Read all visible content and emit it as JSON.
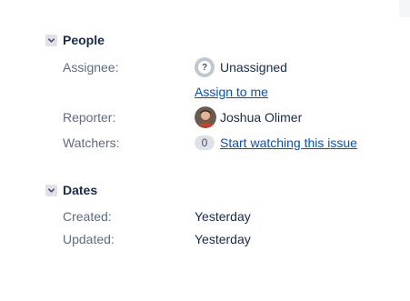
{
  "people": {
    "title": "People",
    "assignee": {
      "label": "Assignee:",
      "value": "Unassigned",
      "assign_link": "Assign to me"
    },
    "reporter": {
      "label": "Reporter:",
      "value": "Joshua Olimer"
    },
    "watchers": {
      "label": "Watchers:",
      "count": "0",
      "watch_link": "Start watching this issue"
    }
  },
  "dates": {
    "title": "Dates",
    "created": {
      "label": "Created:",
      "value": "Yesterday"
    },
    "updated": {
      "label": "Updated:",
      "value": "Yesterday"
    }
  },
  "icons": {
    "collapse": "chevron-down-icon",
    "unassigned": "unassigned-avatar-icon",
    "reporter": "user-avatar"
  },
  "colors": {
    "link": "#0052cc",
    "label": "#5e6c84",
    "text": "#172b4d"
  }
}
